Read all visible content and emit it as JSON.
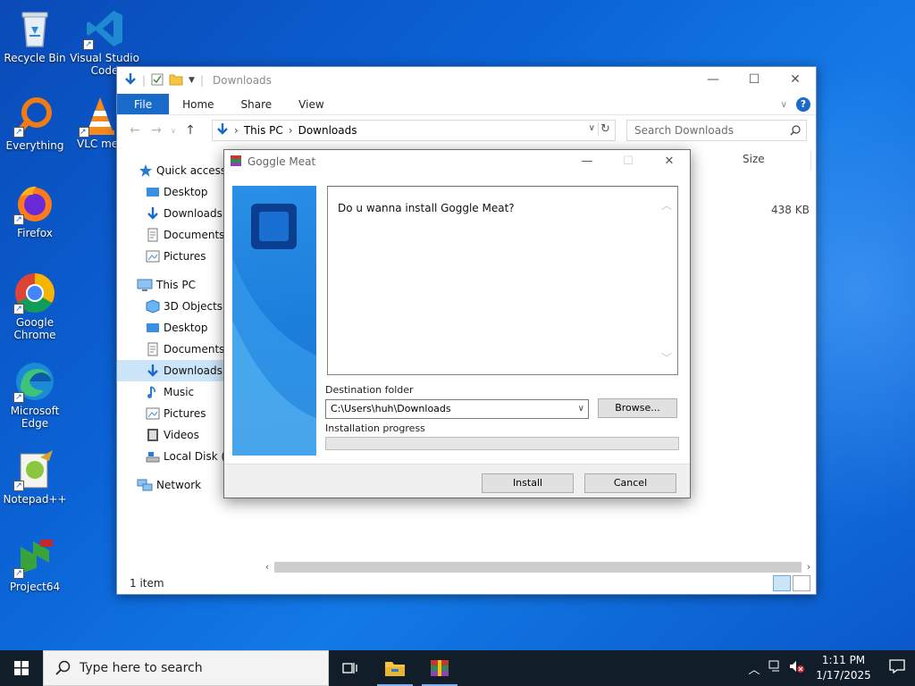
{
  "desktop": {
    "icons": [
      {
        "label": "Recycle Bin"
      },
      {
        "label": "Visual Studio Code"
      },
      {
        "label": "Everything"
      },
      {
        "label": "VLC media player"
      },
      {
        "label": "Firefox"
      },
      {
        "label": "Google Chrome"
      },
      {
        "label": "Microsoft Edge"
      },
      {
        "label": "Notepad++"
      },
      {
        "label": "Project64"
      }
    ]
  },
  "explorer": {
    "title": "Downloads",
    "ribbon_tabs": [
      "File",
      "Home",
      "Share",
      "View"
    ],
    "help": "?",
    "breadcrumb": [
      "This PC",
      "Downloads"
    ],
    "search_placeholder": "Search Downloads",
    "nav": {
      "quick_access": "Quick access",
      "qa_items": [
        "Desktop",
        "Downloads",
        "Documents",
        "Pictures"
      ],
      "this_pc": "This PC",
      "pc_items": [
        "3D Objects",
        "Desktop",
        "Documents",
        "Downloads",
        "Music",
        "Pictures",
        "Videos",
        "Local Disk (C"
      ],
      "network": "Network"
    },
    "column_size": "Size",
    "file_size": "438 KB",
    "status": "1 item"
  },
  "installer": {
    "title": "Goggle Meat",
    "message": "Do u wanna install Goggle Meat?",
    "dest_label": "Destination folder",
    "dest_value": "C:\\Users\\huh\\Downloads",
    "browse": "Browse...",
    "progress_label": "Installation progress",
    "progress": 0,
    "install": "Install",
    "cancel": "Cancel"
  },
  "taskbar": {
    "search_placeholder": "Type here to search",
    "time": "1:11 PM",
    "date": "1/17/2025"
  }
}
